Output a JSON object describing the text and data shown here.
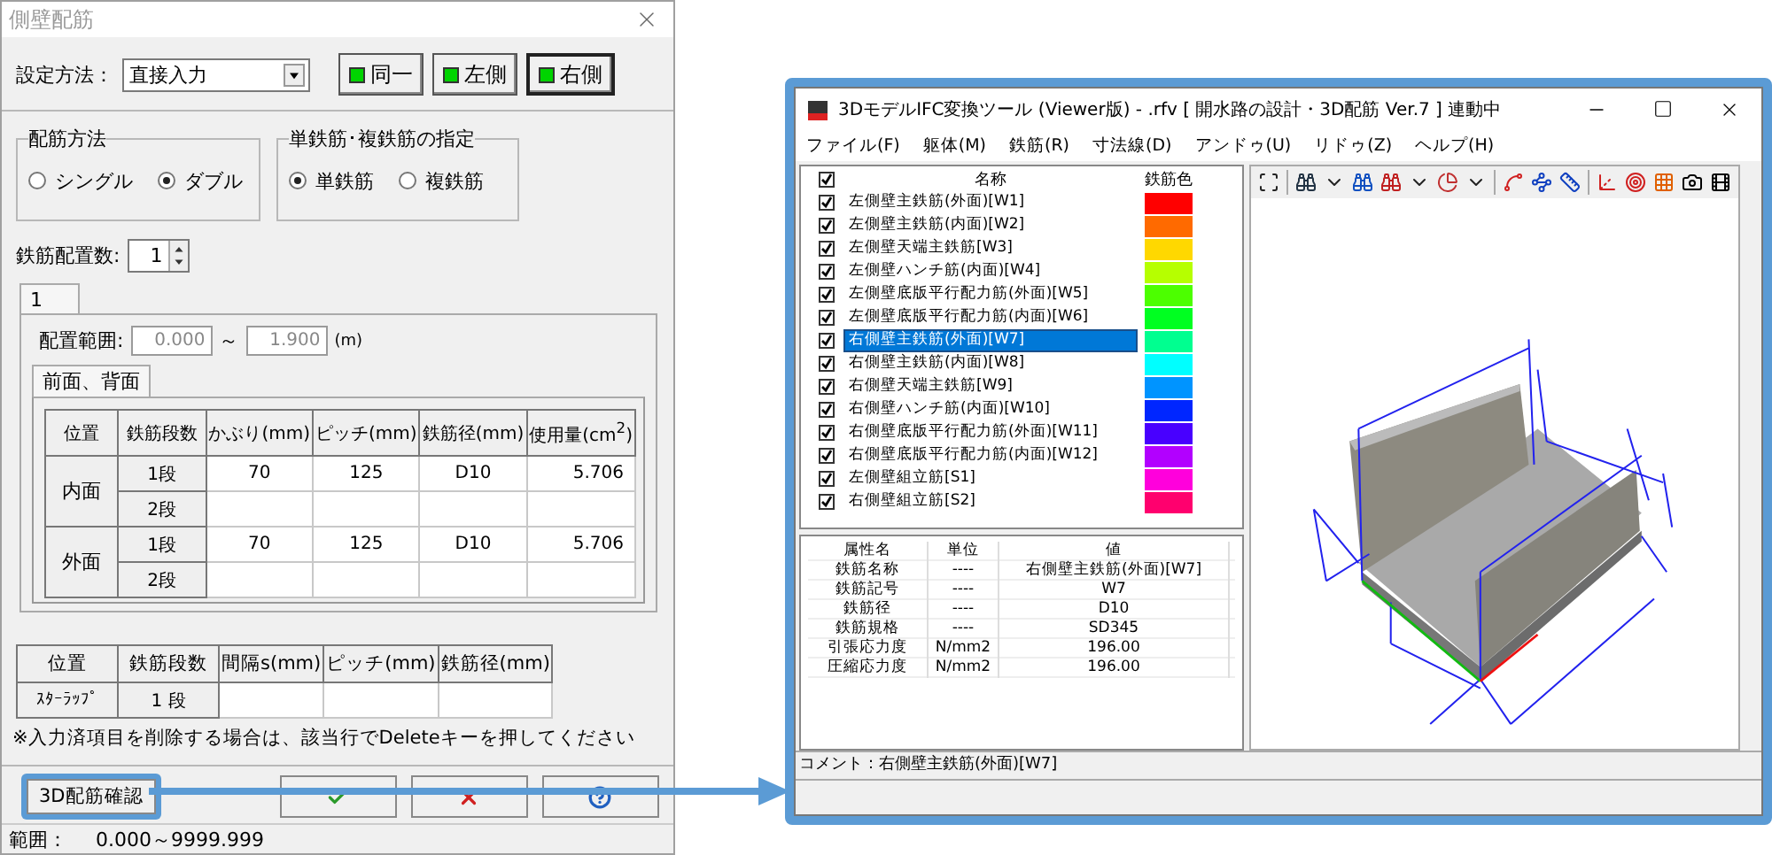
{
  "dialog": {
    "title": "側壁配筋",
    "method": {
      "label": "設定方法：",
      "value": "直接入力",
      "buttons": [
        {
          "label": "同一",
          "selected": false
        },
        {
          "label": "左側",
          "selected": false
        },
        {
          "label": "右側",
          "selected": true
        }
      ]
    },
    "groups": [
      {
        "title": "配筋方法",
        "options": [
          {
            "label": "シングル",
            "selected": false
          },
          {
            "label": "ダブル",
            "selected": true
          }
        ]
      },
      {
        "title": "単鉄筋･複鉄筋の指定",
        "options": [
          {
            "label": "単鉄筋",
            "selected": true
          },
          {
            "label": "複鉄筋",
            "selected": false
          }
        ]
      }
    ],
    "count": {
      "label": "鉄筋配置数:",
      "value": "1"
    },
    "tabs": [
      {
        "label": "1",
        "selected": true
      }
    ],
    "range": {
      "label": "配置範囲:",
      "from": "0.000",
      "separator": "～",
      "to": "1.900",
      "unit": "(m)"
    },
    "subtabs": [
      {
        "label": "前面、背面",
        "selected": true
      }
    ],
    "table": {
      "columns": [
        "位置",
        "鉄筋段数",
        "かぶり(mm)",
        "ピッチ(mm)",
        "鉄筋径(mm)",
        "使用量(cm$^{2}$)"
      ],
      "groups": [
        {
          "position": "内面",
          "rows": [
            {
              "tier": "1段",
              "cover": "70",
              "pitch": "125",
              "diameter": "D10",
              "amount": "5.706"
            },
            {
              "tier": "2段"
            }
          ]
        },
        {
          "position": "外面",
          "rows": [
            {
              "tier": "1段",
              "cover": "70",
              "pitch": "125",
              "diameter": "D10",
              "amount": "5.706"
            },
            {
              "tier": "2段"
            }
          ]
        }
      ]
    },
    "stirrup_table": {
      "columns": [
        "位置",
        "鉄筋段数",
        "間隔s(mm)",
        "ピッチ(mm)",
        "鉄筋径(mm)"
      ],
      "rows": [
        {
          "position": "ｽﾀｰﾗｯﾌﾟ",
          "tier": "1 段"
        }
      ]
    },
    "note": "※入力済項目を削除する場合は、該当行でDeleteキーを押してください",
    "buttons": [
      {
        "label": "3D配筋確認",
        "kind": "highlighted"
      },
      {
        "kind": "ok"
      },
      {
        "kind": "cancel"
      },
      {
        "kind": "help"
      }
    ],
    "status": {
      "label": "範囲：",
      "value": "0.000～9999.999"
    }
  },
  "viewer": {
    "title": "3DモデルIFC変換ツール (Viewer版) - .rfv [ 開水路の設計・3D配筋 Ver.7 ] 連動中",
    "menu": [
      "ファイル(F)",
      "躯体(M)",
      "鉄筋(R)",
      "寸法線(D)",
      "アンドゥ(U)",
      "リドゥ(Z)",
      "ヘルプ(H)"
    ],
    "list": {
      "header_checked": true,
      "columns": [
        "名称",
        "鉄筋色"
      ],
      "rows": [
        {
          "name": "左側壁主鉄筋(外面)[W1]",
          "color": "#ff0000",
          "checked": true,
          "selected": false
        },
        {
          "name": "左側壁主鉄筋(内面)[W2]",
          "color": "#ff6a00",
          "checked": true,
          "selected": false
        },
        {
          "name": "左側壁天端主鉄筋[W3]",
          "color": "#ffd800",
          "checked": true,
          "selected": false
        },
        {
          "name": "左側壁ハンチ筋(内面)[W4]",
          "color": "#b6ff00",
          "checked": true,
          "selected": false
        },
        {
          "name": "左側壁底版平行配力筋(外面)[W5]",
          "color": "#4cff00",
          "checked": true,
          "selected": false
        },
        {
          "name": "左側壁底版平行配力筋(内面)[W6]",
          "color": "#00ff21",
          "checked": true,
          "selected": false
        },
        {
          "name": "右側壁主鉄筋(外面)[W7]",
          "color": "#00ff90",
          "checked": true,
          "selected": true
        },
        {
          "name": "右側壁主鉄筋(内面)[W8]",
          "color": "#00ffff",
          "checked": true,
          "selected": false
        },
        {
          "name": "右側壁天端主鉄筋[W9]",
          "color": "#0094ff",
          "checked": true,
          "selected": false
        },
        {
          "name": "右側壁ハンチ筋(内面)[W10]",
          "color": "#0026ff",
          "checked": true,
          "selected": false
        },
        {
          "name": "右側壁底版平行配力筋(外面)[W11]",
          "color": "#4800ff",
          "checked": true,
          "selected": false
        },
        {
          "name": "右側壁底版平行配力筋(内面)[W12]",
          "color": "#b200ff",
          "checked": true,
          "selected": false
        },
        {
          "name": "左側壁組立筋[S1]",
          "color": "#ff00dc",
          "checked": true,
          "selected": false
        },
        {
          "name": "右側壁組立筋[S2]",
          "color": "#ff006e",
          "checked": true,
          "selected": false
        }
      ]
    },
    "properties": {
      "columns": [
        "属性名",
        "単位",
        "値"
      ],
      "rows": [
        {
          "name": "鉄筋名称",
          "unit": "----",
          "value": "右側壁主鉄筋(外面)[W7]"
        },
        {
          "name": "鉄筋記号",
          "unit": "----",
          "value": "W7"
        },
        {
          "name": "鉄筋径",
          "unit": "----",
          "value": "D10"
        },
        {
          "name": "鉄筋規格",
          "unit": "----",
          "value": "SD345"
        },
        {
          "name": "引張応力度",
          "unit": "N/mm2",
          "value": "196.00"
        },
        {
          "name": "圧縮応力度",
          "unit": "N/mm2",
          "value": "196.00"
        }
      ]
    },
    "comment": "コメント：右側壁主鉄筋(外面)[W7]"
  }
}
